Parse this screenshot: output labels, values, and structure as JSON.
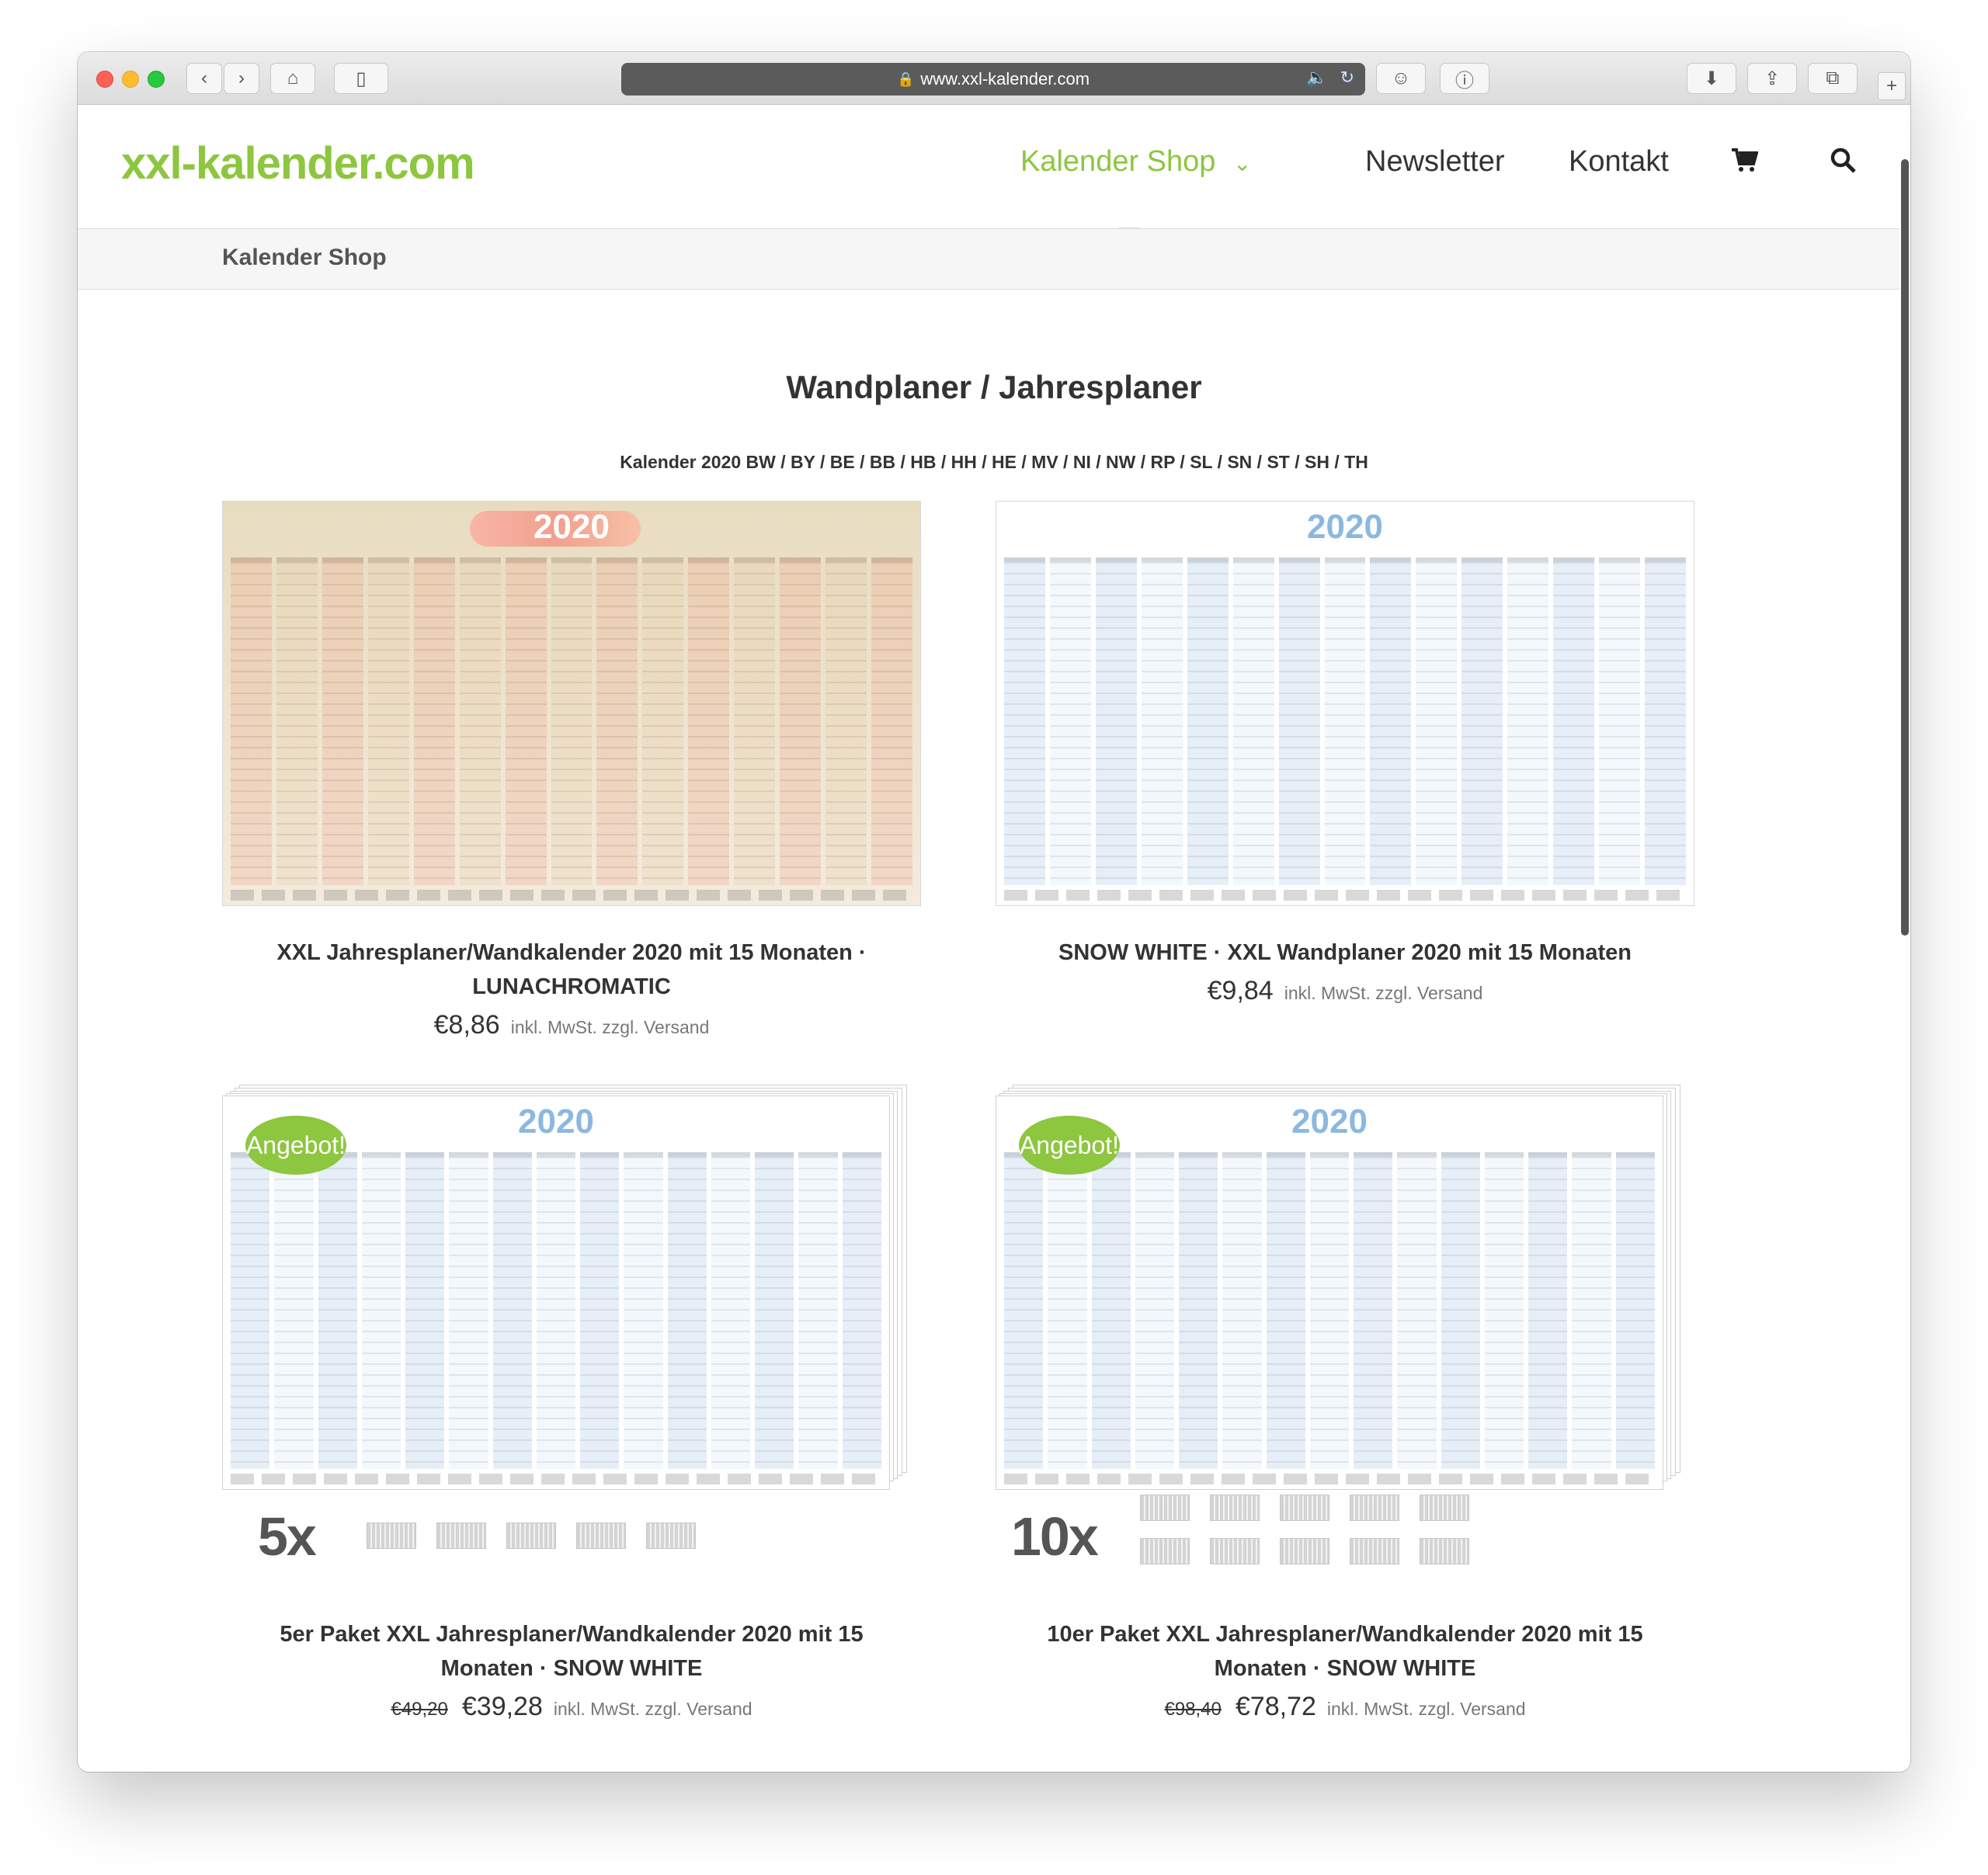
{
  "browser": {
    "url": "www.xxl-kalender.com"
  },
  "site": {
    "logo": "xxl-kalender.com",
    "nav": {
      "shop": "Kalender Shop",
      "shop_chevron": "⌄",
      "newsletter": "Newsletter",
      "kontakt": "Kontakt"
    },
    "breadcrumb": "Kalender Shop",
    "accent": "#8dc63f"
  },
  "page": {
    "title": "Wandplaner / Jahresplaner",
    "subtitle": "Kalender 2020 BW / BY / BE / BB / HB / HH / HE / MV / NI / NW / RP / SL / SN / ST / SH / TH"
  },
  "products": [
    {
      "year": "2020",
      "title_line1": "XXL Jahresplaner/Wandkalender 2020 mit 15 Monaten ·",
      "title_line2": "LUNACHROMATIC",
      "price": "€8,86",
      "tax": "inkl. MwSt. zzgl. Versand"
    },
    {
      "year": "2020",
      "title_line1": "SNOW WHITE · XXL Wandplaner 2020 mit 15 Monaten",
      "price": "€9,84",
      "tax": "inkl. MwSt. zzgl. Versand"
    },
    {
      "year": "2020",
      "badge": "Angebot!",
      "multiplier": "5x",
      "title_line1": "5er Paket XXL Jahresplaner/Wandkalender 2020 mit 15",
      "title_line2": "Monaten · SNOW WHITE",
      "old_price": "€49,20",
      "price": "€39,28",
      "tax": "inkl. MwSt. zzgl. Versand"
    },
    {
      "year": "2020",
      "badge": "Angebot!",
      "multiplier": "10x",
      "title_line1": "10er Paket XXL Jahresplaner/Wandkalender 2020 mit 15",
      "title_line2": "Monaten · SNOW WHITE",
      "old_price": "€98,40",
      "price": "€78,72",
      "tax": "inkl. MwSt. zzgl. Versand"
    }
  ]
}
